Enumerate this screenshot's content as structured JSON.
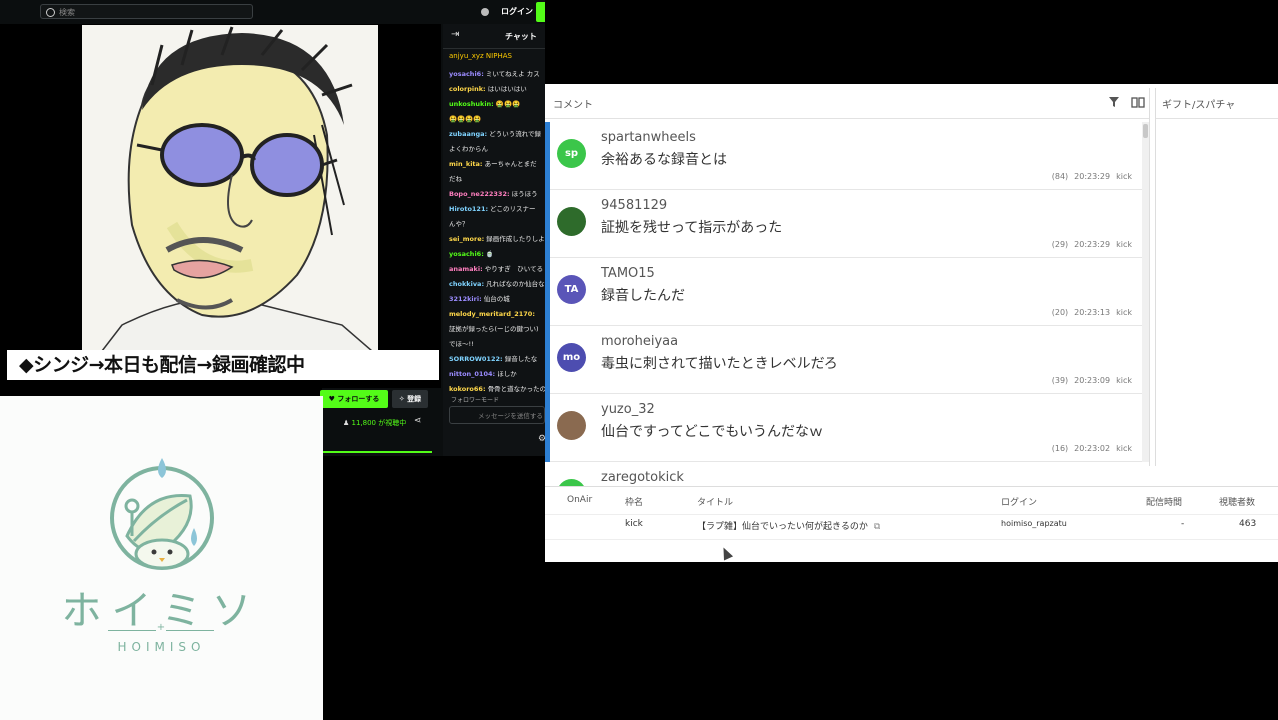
{
  "kick": {
    "search_placeholder": "検索",
    "login": "ログイン",
    "chat_title": "チャット",
    "pinned": "anjyu_xyz   NIPHAS",
    "messages": [
      {
        "user": "yosachi6:",
        "text": "ミいてねえよ カス"
      },
      {
        "user": "colorpink:",
        "text": "はいはいはい"
      },
      {
        "user": "unkoshukin:",
        "text": "🤮🤮🤮"
      },
      {
        "user": "",
        "text": "🤮🤮🤮🤮"
      },
      {
        "user": "zubaanga:",
        "text": "どういう流れで録"
      },
      {
        "user": "",
        "text": "よくわからん"
      },
      {
        "user": "min_kita:",
        "text": "あーちゃんとまだ"
      },
      {
        "user": "",
        "text": "だね"
      },
      {
        "user": "Bopo_ne222332:",
        "text": "ほうほう"
      },
      {
        "user": "Hiroto121:",
        "text": "どこのリスナー"
      },
      {
        "user": "",
        "text": "んや？"
      },
      {
        "user": "sei_more:",
        "text": "録画作成したりしよ"
      },
      {
        "user": "yosachi6:",
        "text": "🍵"
      },
      {
        "user": "anamaki:",
        "text": "やりすぎ　ひいてる"
      },
      {
        "user": "chokkiva:",
        "text": "凡ればなのか仙台な"
      },
      {
        "user": "3212kiri:",
        "text": "仙台の城"
      },
      {
        "user": "melody_meritard_2170:",
        "text": ""
      },
      {
        "user": "",
        "text": "証拠が録ったら(ーじの鍵つい)"
      },
      {
        "user": "",
        "text": "でほ〜!!"
      },
      {
        "user": "SORROW0122:",
        "text": "録音したな"
      },
      {
        "user": "nitton_0104:",
        "text": "ほしか"
      },
      {
        "user": "kokoro66:",
        "text": "骨骨と道なかったの"
      }
    ],
    "chat_rules": "フォロワーモード",
    "chat_input_placeholder": "メッセージを送信する",
    "follow_label": "フォローする",
    "subscribe_label": "登録",
    "viewers": "11,800 が視聴中",
    "caption": "◆シンジ→本日も配信→録画確認中"
  },
  "logo": {
    "jp": "ホイミソ",
    "en": "HOIMISO"
  },
  "viewer": {
    "comments_title": "コメント",
    "gift_title": "ギフト/スパチャ",
    "comments": [
      {
        "avatar": "sp",
        "avatar_color": "#3bc64a",
        "user": "spartanwheels",
        "text": "余裕あるな録音とは",
        "count": "(84)",
        "time": "20:23:29",
        "site": "kick"
      },
      {
        "avatar": "",
        "avatar_color": "#2e6b2b",
        "user": "94581129",
        "text": "証拠を残せって指示があった",
        "count": "(29)",
        "time": "20:23:29",
        "site": "kick"
      },
      {
        "avatar": "TA",
        "avatar_color": "#5a55b8",
        "user": "TAMO15",
        "text": "録音したんだ",
        "count": "(20)",
        "time": "20:23:13",
        "site": "kick"
      },
      {
        "avatar": "mo",
        "avatar_color": "#4d4db0",
        "user": "moroheiyaa",
        "text": "毒虫に刺されて描いたときレベルだろ",
        "count": "(39)",
        "time": "20:23:09",
        "site": "kick"
      },
      {
        "avatar": "",
        "avatar_color": "#8a6a50",
        "user": "yuzo_32",
        "text": "仙台ですってどこでもいうんだなｗ",
        "count": "(16)",
        "time": "20:23:02",
        "site": "kick"
      },
      {
        "avatar": "",
        "avatar_color": "#3bc64a",
        "user": "zaregotokick",
        "text": "",
        "count": "",
        "time": "",
        "site": ""
      }
    ],
    "table": {
      "headers": [
        "OnAir",
        "枠名",
        "タイトル",
        "ログイン",
        "配信時間",
        "視聴者数"
      ],
      "row": {
        "onair": "",
        "platform": "kick",
        "title": "【ラプ雑】仙台でいったい何が起きるのか",
        "login": "hoimiso_rapzatu",
        "duration": "-",
        "viewers": "463"
      }
    }
  }
}
